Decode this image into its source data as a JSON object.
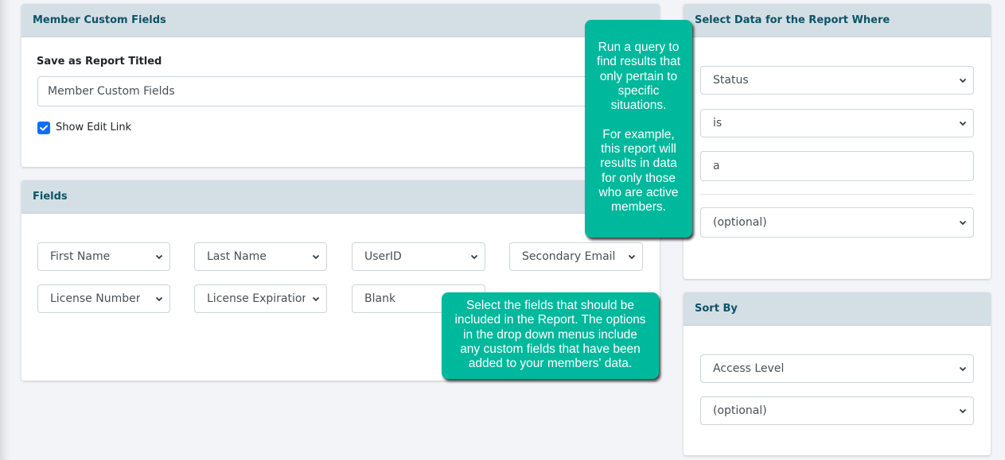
{
  "panels": {
    "report": {
      "title": "Member Custom Fields",
      "save_label": "Save as Report Titled",
      "title_input_value": "Member Custom Fields",
      "show_edit_link_label": "Show Edit Link",
      "show_edit_link_checked": true
    },
    "fields": {
      "title": "Fields",
      "selects": [
        "First Name",
        "Last Name",
        "UserID",
        "Secondary Email",
        "License Number",
        "License Expiration",
        "Blank"
      ]
    },
    "where": {
      "title": "Select Data for the Report Where",
      "field_select": "Status",
      "operator_select": "is",
      "value_input": "a",
      "extra_select": "(optional)"
    },
    "sort": {
      "title": "Sort By",
      "primary_select": "Access Level",
      "secondary_select": "(optional)"
    }
  },
  "tooltips": {
    "query": "Run a query to\nfind results that\nonly pertain to\nspecific\nsituations.\n\nFor example,\nthis report will\nresults in data\nfor only those\nwho are active\nmembers.",
    "fields": "Select the fields that should be\nincluded in the Report. The options\nin the drop down menus include\nany custom fields that have been\nadded to your members' data."
  },
  "colors": {
    "header_bg": "#d3dfe5",
    "header_text": "#0d5366",
    "tooltip_bg": "#00b89c",
    "checkbox": "#0d6efd",
    "page_bg": "#f3f4f8"
  }
}
